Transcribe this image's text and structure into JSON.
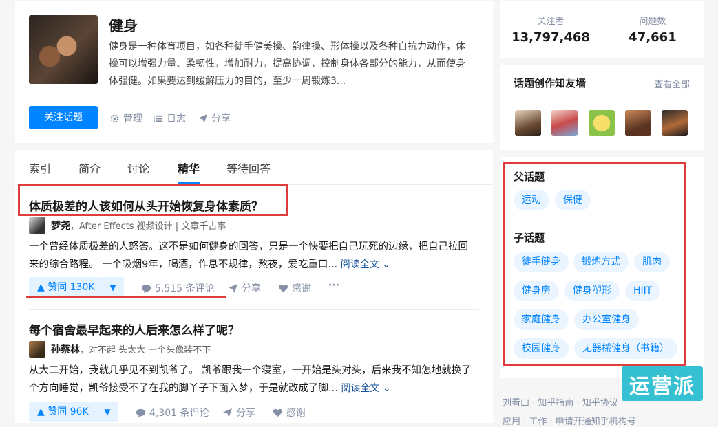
{
  "topic": {
    "title": "健身",
    "desc": "健身是一种体育项目，如各种徒手健美操、韵律操、形体操以及各种自抗力动作，体操可以增强力量、柔韧性，增加耐力，提高协调，控制身体各部分的能力，从而使身体强健。如果要达到缓解压力的目的，至少一周锻炼3...",
    "follow": "关注话题",
    "manage": "管理",
    "log": "日志",
    "share": "分享"
  },
  "tabs": [
    "索引",
    "简介",
    "讨论",
    "精华",
    "等待回答"
  ],
  "answers": [
    {
      "title": "体质极差的人该如何从头开始恢复身体素质？",
      "author": "梦尧",
      "bio": "，After Effects 视频设计 | 文章千古事",
      "excerpt": "一个曾经体质极差的人怒答。这不是如何健身的回答，只是一个快要把自己玩死的边缘，把自己拉回来的综合路程。 一个吸烟9年，喝酒，作息不规律，熬夜，爱吃重口...",
      "read_all": "阅读全文",
      "votes": "赞同 130K",
      "comments": "5,515 条评论",
      "share": "分享",
      "thanks": "感谢"
    },
    {
      "title": "每个宿舍最早起来的人后来怎么样了呢？",
      "author": "孙蔡林",
      "bio": "，对不起 头太大 一个头像装不下",
      "excerpt": "从大二开始，我就几乎见不到凯爷了。 凯爷跟我一个寝室，一开始是头对头，后来我不知怎地就换了个方向睡觉，凯爷接受不了在我的脚丫子下面入梦，于是就改成了脚...",
      "read_all": "阅读全文",
      "votes": "赞同 96K",
      "comments": "4,301 条评论",
      "share": "分享",
      "thanks": "感谢"
    }
  ],
  "stats": {
    "followers_label": "关注者",
    "followers": "13,797,468",
    "questions_label": "问题数",
    "questions": "47,661"
  },
  "wall": {
    "title": "话题创作知友墙",
    "view_all": "查看全部"
  },
  "parent": {
    "title": "父话题",
    "tags": [
      "运动",
      "保健"
    ]
  },
  "children": {
    "title": "子话题",
    "tags": [
      "徒手健身",
      "锻炼方式",
      "肌肉",
      "健身房",
      "健身塑形",
      "HIIT",
      "家庭健身",
      "办公室健身",
      "校园健身",
      "无器械健身（书籍）"
    ]
  },
  "footer": {
    "line1": "刘看山 · 知乎指南 · 知乎协议",
    "line2": "应用 · 工作 · 申请开通知乎机构号"
  },
  "watermark": "运营派",
  "colors": {
    "accent": "#0084ff",
    "highlight": "#e03c3c"
  }
}
